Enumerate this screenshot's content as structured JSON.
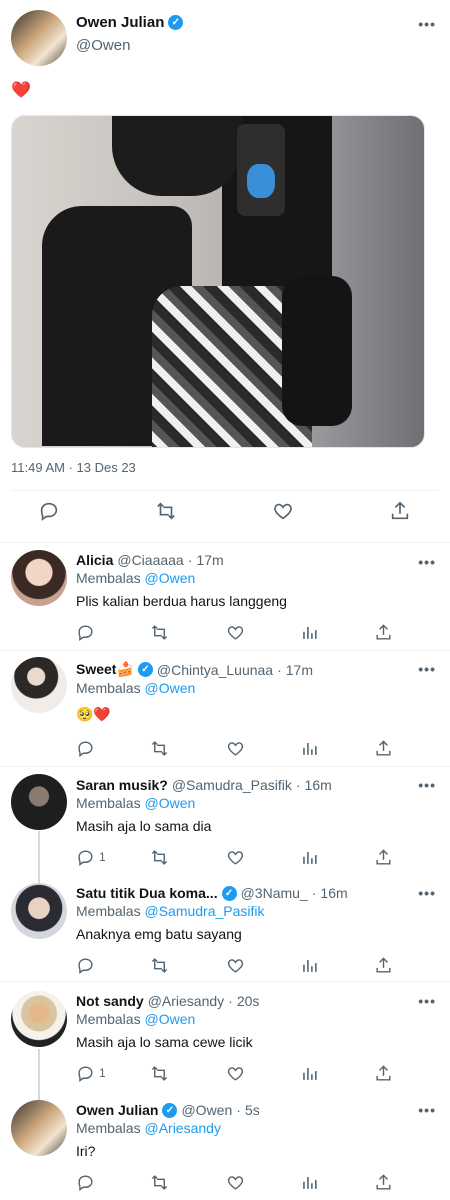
{
  "main_tweet": {
    "name": "Owen Julian",
    "handle": "@Owen",
    "text": "❤️",
    "timestamp": "11:49 AM · 13 Des 23",
    "verified": true,
    "more_icon": "more-horizontal-icon"
  },
  "actions": [
    "reply-icon",
    "retweet-icon",
    "like-icon",
    "stats-icon",
    "share-icon"
  ],
  "replies": [
    {
      "name": "Alicia",
      "handle": "@Ciaaaaa",
      "time": "17m",
      "replying_label": "Membalas",
      "replying_to": "@Owen",
      "text": "Plis kalian berdua harus langgeng",
      "reply_count": "",
      "verified": false
    },
    {
      "name": "Sweet🍰",
      "handle": "@Chintya_Luunaa",
      "time": "17m",
      "replying_label": "Membalas",
      "replying_to": "@Owen",
      "text": "🥺❤️",
      "reply_count": "",
      "verified": true
    },
    {
      "name": "Saran musik?",
      "handle": "@Samudra_Pasifik",
      "time": "16m",
      "replying_label": "Membalas",
      "replying_to": "@Owen",
      "text": "Masih aja lo sama dia",
      "reply_count": "1",
      "verified": false
    },
    {
      "name": "Satu titik Dua koma...",
      "handle": "@3Namu_",
      "time": "16m",
      "replying_label": "Membalas",
      "replying_to": "@Samudra_Pasifik",
      "text": "Anaknya emg batu sayang",
      "reply_count": "",
      "verified": true
    },
    {
      "name": "Not sandy",
      "handle": "@Ariesandy",
      "time": "20s",
      "replying_label": "Membalas",
      "replying_to": "@Owen",
      "text": "Masih aja lo sama cewe licik",
      "reply_count": "1",
      "verified": false
    },
    {
      "name": "Owen Julian",
      "handle": "@Owen",
      "time": "5s",
      "replying_label": "Membalas",
      "replying_to": "@Ariesandy",
      "text": "Iri?",
      "reply_count": "",
      "verified": true
    }
  ],
  "colors": {
    "accent": "#1d9bf0",
    "text": "#0f1419",
    "muted": "#536471",
    "divider": "#eff3f4"
  }
}
